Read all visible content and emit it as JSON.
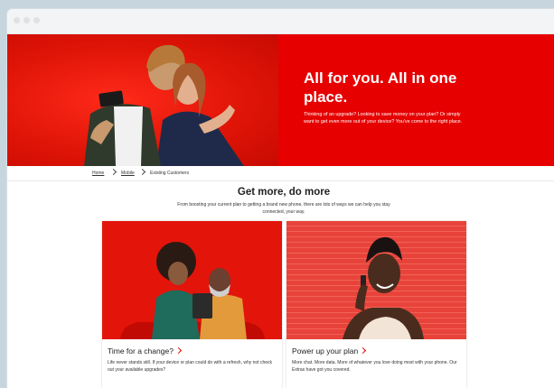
{
  "hero": {
    "title": "All for you. All in one place.",
    "body": "Thinking of an upgrade? Looking to save money on your plan? Or simply want to get even more out of your device? You've come to the right place."
  },
  "breadcrumb": {
    "items": [
      "Home",
      "Mobile",
      "Existing Customers"
    ]
  },
  "section": {
    "title": "Get more, do more",
    "subtitle": "From boosting your current plan to getting a brand new phone, there are lots of ways we can help you stay connected, your way."
  },
  "cards": [
    {
      "title": "Time for a change?",
      "text": "Life never stands still. If your device or plan could do with a refresh, why not check out your available upgrades?"
    },
    {
      "title": "Power up your plan",
      "text": "More chat. More data. More of whatever you love doing most with your phone. Our Extras have got you covered."
    }
  ],
  "colors": {
    "brand_red": "#e60000",
    "background": "#c7d6de"
  }
}
